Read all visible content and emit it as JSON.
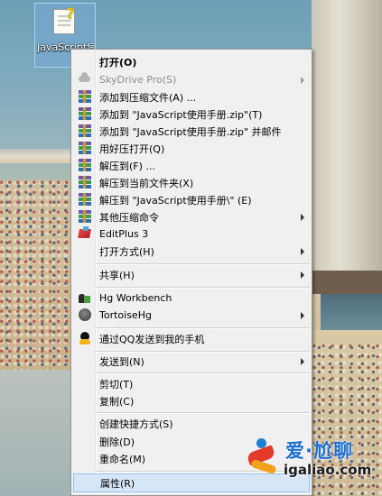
{
  "desktop": {
    "icon_label": "JavaScript使用手册"
  },
  "menu": {
    "items": [
      {
        "label": "打开(O)",
        "bold": true,
        "icon": ""
      },
      {
        "label": "SkyDrive Pro(S)",
        "disabled": true,
        "submenu": true,
        "icon": "cloud-icon"
      },
      {
        "label": "添加到压缩文件(A) ...",
        "icon": "winrar-icon"
      },
      {
        "label": "添加到 \"JavaScript使用手册.zip\"(T)",
        "icon": "winrar-icon"
      },
      {
        "label": "添加到 \"JavaScript使用手册.zip\" 并邮件",
        "icon": "winrar-icon"
      },
      {
        "label": "用好压打开(Q)",
        "icon": "winrar-icon"
      },
      {
        "label": "解压到(F) ...",
        "icon": "winrar-icon"
      },
      {
        "label": "解压到当前文件夹(X)",
        "icon": "winrar-icon"
      },
      {
        "label": "解压到 \"JavaScript使用手册\\\" (E)",
        "icon": "winrar-icon"
      },
      {
        "label": "其他压缩命令",
        "submenu": true,
        "icon": "winrar-icon"
      },
      {
        "label": "EditPlus 3",
        "icon": "editplus-icon"
      },
      {
        "label": "打开方式(H)",
        "submenu": true,
        "icon": ""
      },
      {
        "label": "共享(H)",
        "submenu": true,
        "icon": ""
      },
      {
        "label": "Hg Workbench",
        "icon": "hg-workbench-icon"
      },
      {
        "label": "TortoiseHg",
        "submenu": true,
        "icon": "tortoisehg-icon"
      },
      {
        "label": "通过QQ发送到我的手机",
        "icon": "qq-icon"
      },
      {
        "label": "发送到(N)",
        "submenu": true,
        "icon": ""
      },
      {
        "label": "剪切(T)",
        "icon": ""
      },
      {
        "label": "复制(C)",
        "icon": ""
      },
      {
        "label": "创建快捷方式(S)",
        "icon": ""
      },
      {
        "label": "删除(D)",
        "icon": ""
      },
      {
        "label": "重命名(M)",
        "icon": ""
      },
      {
        "label": "属性(R)",
        "highlighted": true,
        "icon": ""
      }
    ]
  },
  "watermark": {
    "title": "爱·尬聊",
    "url": "igaliao.com"
  },
  "colors": {
    "menu_background": "#f0f0f0",
    "highlight": "#d7e6f7",
    "disabled_text": "#8d8d8d",
    "watermark_blue": "#1e6fcf"
  }
}
